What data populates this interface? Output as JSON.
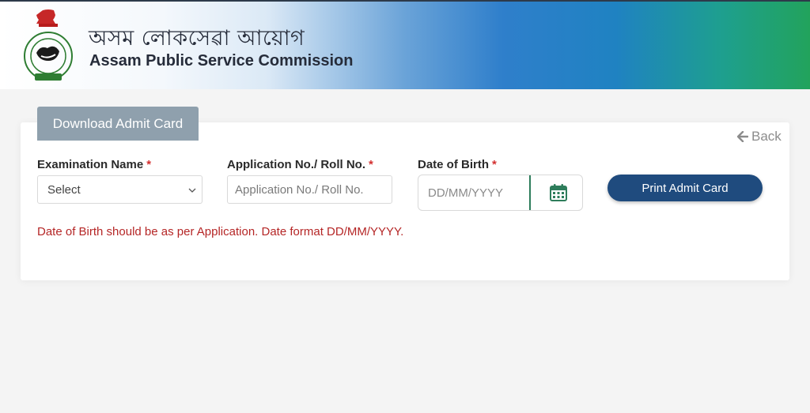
{
  "header": {
    "title_bn": "অসম লোকসেৱা আয়োগ",
    "title_en": "Assam Public Service Commission",
    "logo_text": "ASSAM PUBLIC SERVICE COMMISSION"
  },
  "tab": {
    "label": "Download Admit Card"
  },
  "back": {
    "icon": "arrow-left-icon",
    "label": "Back"
  },
  "form": {
    "exam_name": {
      "label": "Examination Name",
      "required_mark": "*",
      "selected": "Select"
    },
    "roll_no": {
      "label": "Application No./ Roll No.",
      "required_mark": "*",
      "placeholder": "Application No./ Roll No.",
      "value": ""
    },
    "dob": {
      "label": "Date of Birth",
      "required_mark": "*",
      "placeholder": "DD/MM/YYYY",
      "value": "",
      "icon": "calendar-icon"
    },
    "print_label": "Print Admit Card",
    "hint": "Date of Birth should be as per Application. Date format DD/MM/YYYY."
  },
  "colors": {
    "primary_button": "#1f4b7e",
    "tab_button": "#8fa0ad",
    "required": "#d32f2f",
    "hint_text": "#b52626",
    "calendar": "#2e7d5b"
  }
}
